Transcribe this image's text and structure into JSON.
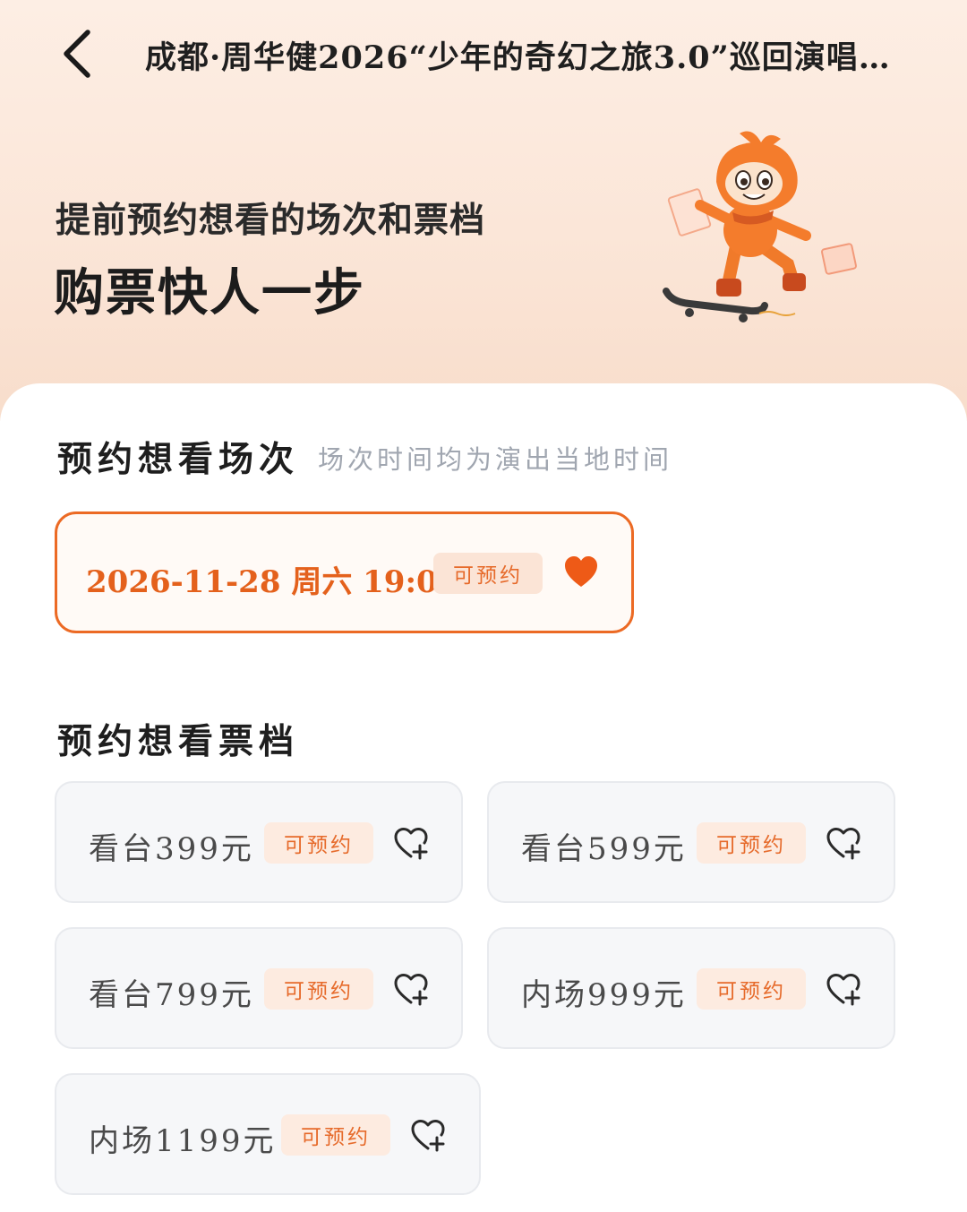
{
  "header": {
    "title": "成都·周华健2026“少年的奇幻之旅3.0”巡回演唱…",
    "back_icon": "chevron-left-icon"
  },
  "promo": {
    "line1": "提前预约想看的场次和票档",
    "line2": "购票快人一步",
    "mascot_icon": "skateboard-mascot-illustration"
  },
  "sessions_section": {
    "title": "预约想看场次",
    "hint": "场次时间均为演出当地时间",
    "sessions": [
      {
        "label": "2026-11-28 周六 19:00",
        "badge": "可预约",
        "favorited": true
      }
    ]
  },
  "tiers_section": {
    "title": "预约想看票档",
    "tiers": [
      {
        "label": "看台399元",
        "badge": "可预约"
      },
      {
        "label": "看台599元",
        "badge": "可预约"
      },
      {
        "label": "看台799元",
        "badge": "可预约"
      },
      {
        "label": "内场999元",
        "badge": "可预约"
      },
      {
        "label": "内场1199元",
        "badge": "可预约"
      }
    ]
  },
  "colors": {
    "accent": "#e4611c",
    "badge_bg": "#fdebe0",
    "hero_bg": "#fbe6d8"
  }
}
